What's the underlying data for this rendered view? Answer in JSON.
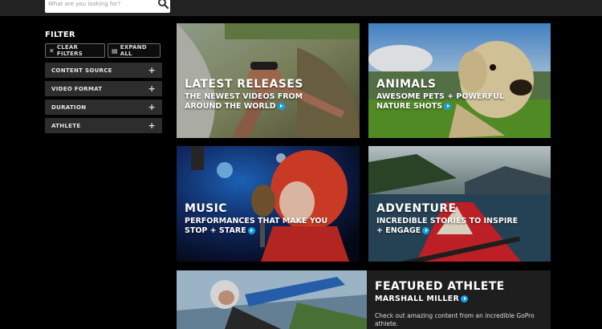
{
  "search": {
    "placeholder": "What are you looking for?"
  },
  "filter": {
    "title": "FILTER",
    "clear_label": "CLEAR FILTERS",
    "expand_label": "EXPAND ALL",
    "items": [
      {
        "label": "CONTENT SOURCE"
      },
      {
        "label": "VIDEO FORMAT"
      },
      {
        "label": "DURATION"
      },
      {
        "label": "ATHLETE"
      }
    ]
  },
  "tiles": [
    {
      "title": "LATEST RELEASES",
      "sub1": "THE NEWEST VIDEOS FROM",
      "sub2": "AROUND THE WORLD"
    },
    {
      "title": "ANIMALS",
      "sub1": "AWESOME PETS + POWERFUL",
      "sub2": "NATURE SHOTS"
    },
    {
      "title": "MUSIC",
      "sub1": "PERFORMANCES THAT MAKE YOU",
      "sub2": "STOP + STARE"
    },
    {
      "title": "ADVENTURE",
      "sub1": "INCREDIBLE STORIES TO INSPIRE",
      "sub2": "+ ENGAGE"
    }
  ],
  "featured": {
    "title": "FEATURED ATHLETE",
    "name": "MARSHALL MILLER",
    "description": "Check out amazing content from an incredible GoPro athlete."
  },
  "colors": {
    "accent": "#14a3e0",
    "panel": "#2d2d2d",
    "topbar": "#222222"
  }
}
